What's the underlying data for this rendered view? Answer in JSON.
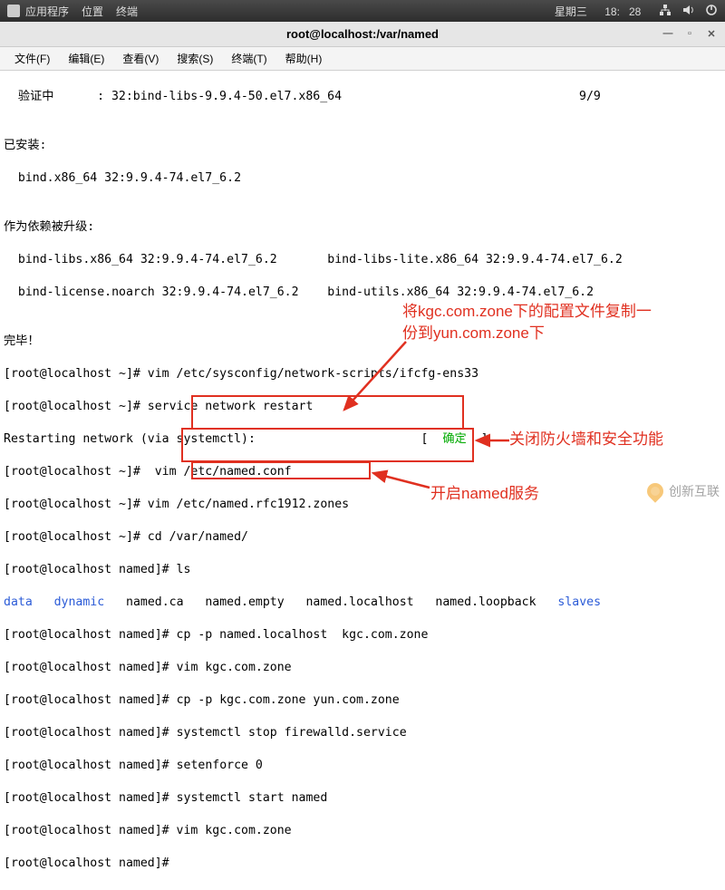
{
  "panel": {
    "apps": "应用程序",
    "places": "位置",
    "terminal": "终端",
    "date": "星期三",
    "time1": "18",
    "time2": "28"
  },
  "title": "root@localhost:/var/named",
  "menu": {
    "file": "文件(F)",
    "edit": "编辑(E)",
    "view": "查看(V)",
    "search": "搜索(S)",
    "terminal": "终端(T)",
    "help": "帮助(H)"
  },
  "term": {
    "l1": "  验证中      : 32:bind-libs-9.9.4-50.el7.x86_64                                 9/9",
    "l2": "",
    "l3": "已安装:",
    "l4": "  bind.x86_64 32:9.9.4-74.el7_6.2",
    "l5": "",
    "l6": "作为依赖被升级:",
    "l7": "  bind-libs.x86_64 32:9.9.4-74.el7_6.2       bind-libs-lite.x86_64 32:9.9.4-74.el7_6.2",
    "l8": "  bind-license.noarch 32:9.9.4-74.el7_6.2    bind-utils.x86_64 32:9.9.4-74.el7_6.2",
    "l9": "",
    "l10": "完毕！",
    "l11": "[root@localhost ~]# vim /etc/sysconfig/network-scripts/ifcfg-ens33",
    "l12": "[root@localhost ~]# service network restart",
    "l13a": "Restarting network (via systemctl):                       [  ",
    "l13b": "确定",
    "l13c": "  ]",
    "l14": "[root@localhost ~]#  vim /etc/named.conf",
    "l15": "[root@localhost ~]# vim /etc/named.rfc1912.zones",
    "l16": "[root@localhost ~]# cd /var/named/",
    "l17": "[root@localhost named]# ls",
    "l18a": "data",
    "l18b": "dynamic",
    "l18c": "named.ca   named.empty   named.localhost   named.loopback",
    "l18d": "slaves",
    "l19": "[root@localhost named]# cp -p named.localhost  kgc.com.zone",
    "l20a": "[root@localhost named]# ",
    "l20b": "vim kgc.com.zone",
    "l21a": "[root@localhost named]# ",
    "l21b": "cp -p kgc.com.zone yun.com.zone",
    "l22a": "[root@localhost named]# ",
    "l22b": "systemctl stop firewalld.service",
    "l23a": "[root@localhost named]# ",
    "l23b": "setenforce 0",
    "l24a": "[root@localhost named]# ",
    "l24b": "systemctl start named",
    "l25": "[root@localhost named]# vim kgc.com.zone",
    "l26": "[root@localhost named]# "
  },
  "anno": {
    "a1_l1": "将kgc.com.zone下的配置文件复制一",
    "a1_l2": "份到yun.com.zone下",
    "a2": "关闭防火墙和安全功能",
    "a3": "开启named服务"
  },
  "watermark": "创新互联"
}
